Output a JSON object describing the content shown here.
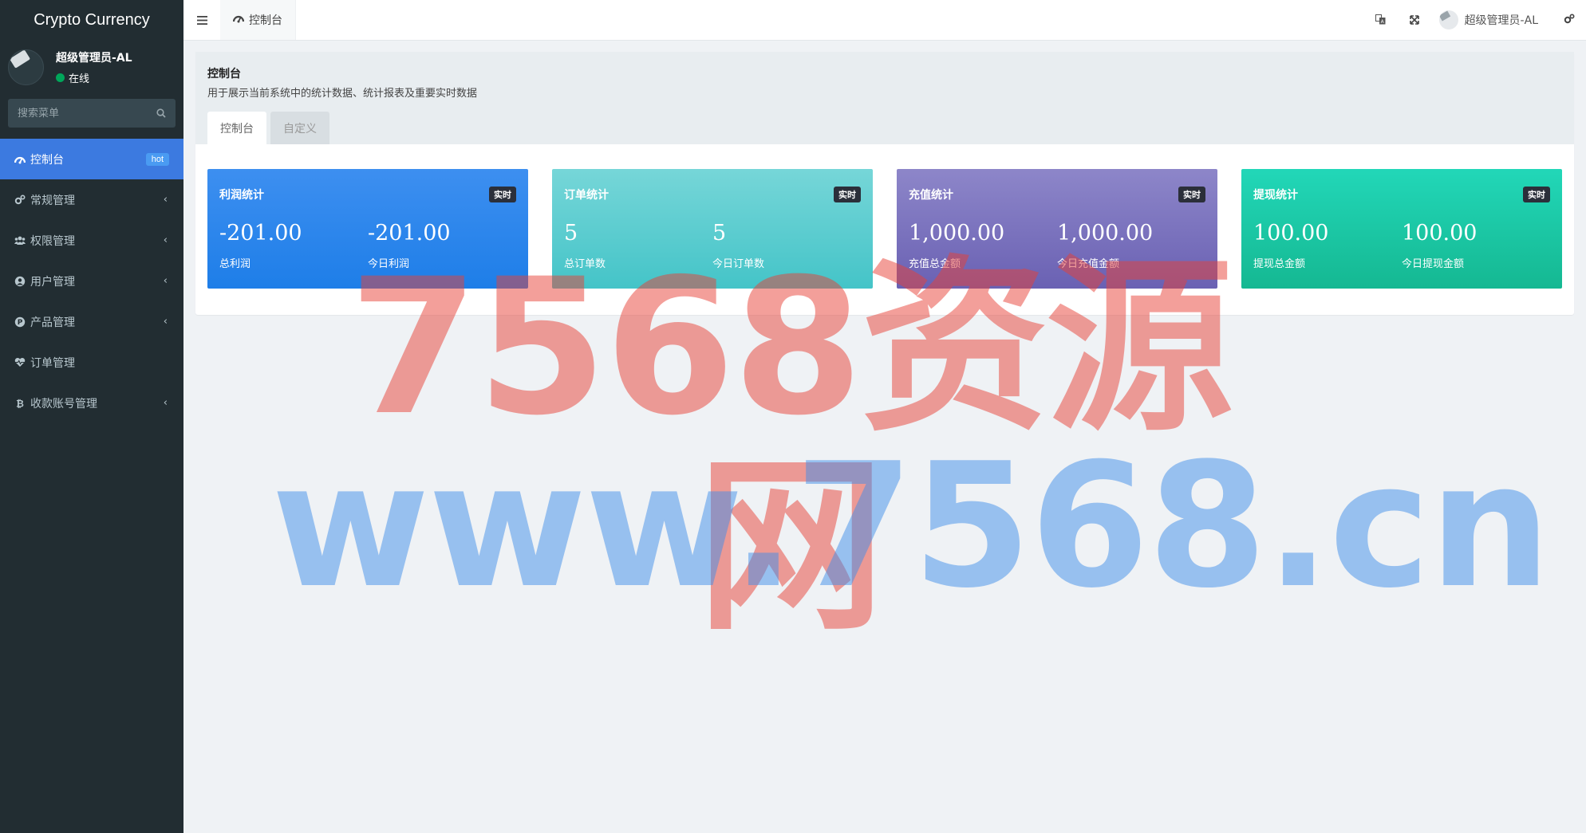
{
  "sidebar": {
    "brand": "Crypto Currency",
    "user": {
      "name": "超级管理员-AL",
      "status": "在线"
    },
    "search": {
      "placeholder": "搜索菜单"
    },
    "items": [
      {
        "label": "控制台",
        "badge": "hot",
        "icon": "dashboard-icon"
      },
      {
        "label": "常规管理",
        "icon": "cogs-icon"
      },
      {
        "label": "权限管理",
        "icon": "group-icon"
      },
      {
        "label": "用户管理",
        "icon": "user-circle-icon"
      },
      {
        "label": "产品管理",
        "icon": "product-icon"
      },
      {
        "label": "订单管理",
        "icon": "heartbeat-icon"
      },
      {
        "label": "收款账号管理",
        "icon": "bitcoin-icon"
      }
    ]
  },
  "header": {
    "tab_label": "控制台",
    "user_name": "超级管理员-AL"
  },
  "page": {
    "title": "控制台",
    "description": "用于展示当前系统中的统计数据、统计报表及重要实时数据",
    "tabs": [
      "控制台",
      "自定义"
    ]
  },
  "cards": [
    {
      "title": "利润统计",
      "badge": "实时",
      "stats": [
        {
          "value": "-201.00",
          "label": "总利润"
        },
        {
          "value": "-201.00",
          "label": "今日利润"
        }
      ]
    },
    {
      "title": "订单统计",
      "badge": "实时",
      "stats": [
        {
          "value": "5",
          "label": "总订单数"
        },
        {
          "value": "5",
          "label": "今日订单数"
        }
      ]
    },
    {
      "title": "充值统计",
      "badge": "实时",
      "stats": [
        {
          "value": "1,000.00",
          "label": "充值总金额"
        },
        {
          "value": "1,000.00",
          "label": "今日充值金额"
        }
      ]
    },
    {
      "title": "提现统计",
      "badge": "实时",
      "stats": [
        {
          "value": "100.00",
          "label": "提现总金额"
        },
        {
          "value": "100.00",
          "label": "今日提现金额"
        }
      ]
    }
  ],
  "watermark": {
    "line1": "7568资源网",
    "line2": "www.7568.cn"
  },
  "colors": {
    "sidebar": "#222d32",
    "active": "#3c7ae0",
    "card_blue": "#1e7ee8",
    "card_cyan": "#44c4c8",
    "card_purple": "#6a61b3",
    "card_green": "#15b892"
  }
}
